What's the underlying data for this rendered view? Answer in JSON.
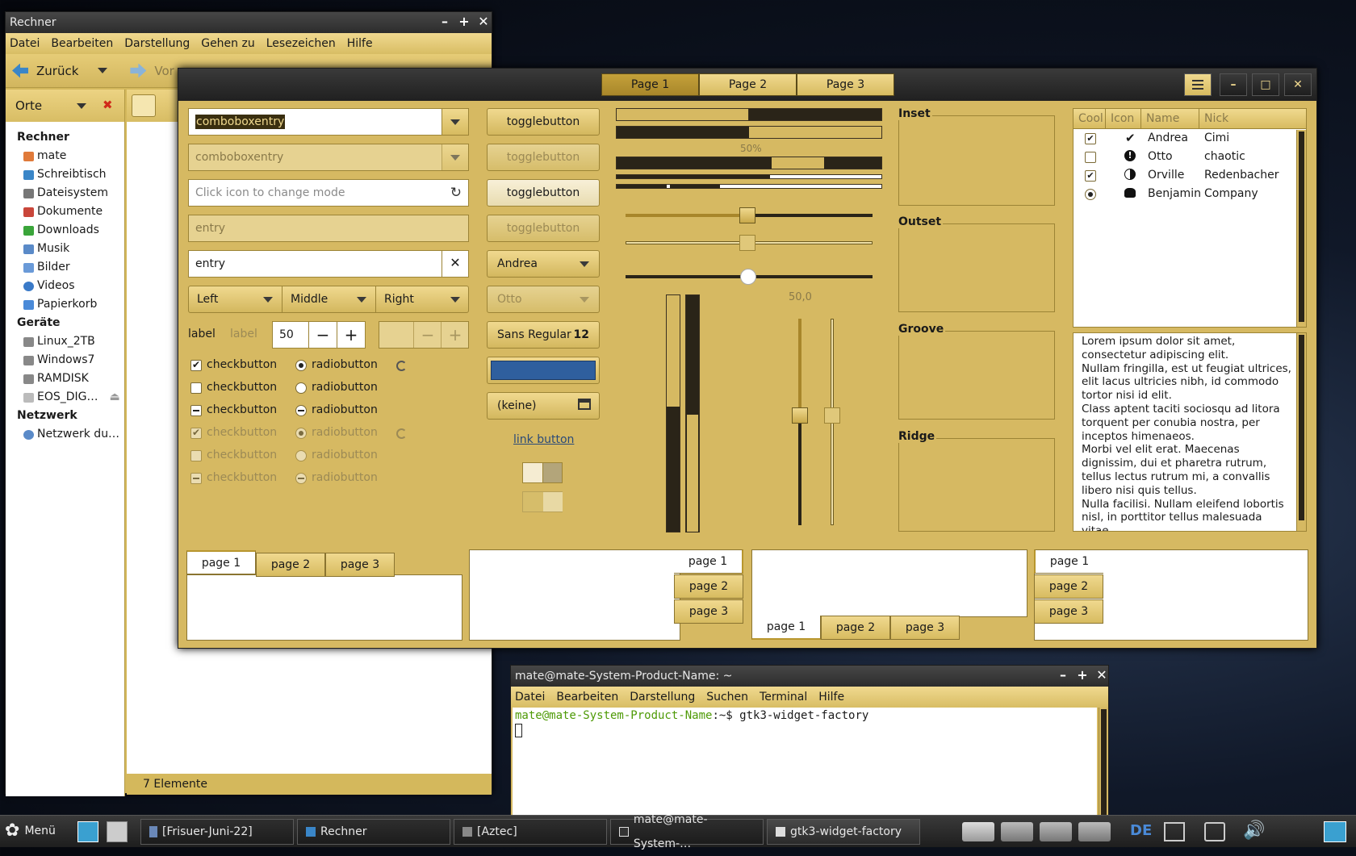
{
  "file_manager": {
    "title": "Rechner",
    "menu": [
      "Datei",
      "Bearbeiten",
      "Darstellung",
      "Gehen zu",
      "Lesezeichen",
      "Hilfe"
    ],
    "back_label": "Zurück",
    "forward_label": "Vor",
    "places_label": "Orte",
    "sections": [
      {
        "title": "Rechner",
        "items": [
          "mate",
          "Schreibtisch",
          "Dateisystem",
          "Dokumente",
          "Downloads",
          "Musik",
          "Bilder",
          "Videos",
          "Papierkorb"
        ]
      },
      {
        "title": "Geräte",
        "items": [
          "Linux_2TB",
          "Windows7",
          "RAMDISK",
          "EOS_DIG…"
        ]
      },
      {
        "title": "Netzwerk",
        "items": [
          "Netzwerk du…"
        ]
      }
    ],
    "status": "7 Elemente"
  },
  "widget_factory": {
    "stack_tabs": [
      "Page 1",
      "Page 2",
      "Page 3"
    ],
    "combo1": "comboboxentry",
    "combo2": "comboboxentry",
    "entry_placeholder": "Click icon to change mode",
    "entry_disabled": "entry",
    "entry_clear": "entry",
    "seg": [
      "Left",
      "Middle",
      "Right"
    ],
    "label1": "label",
    "label2": "label",
    "spin_value": "50",
    "checks": [
      "checkbutton",
      "checkbutton",
      "checkbutton",
      "checkbutton",
      "checkbutton",
      "checkbutton"
    ],
    "radios": [
      "radiobutton",
      "radiobutton",
      "radiobutton",
      "radiobutton",
      "radiobutton",
      "radiobutton"
    ],
    "toggles": [
      "togglebutton",
      "togglebutton",
      "togglebutton",
      "togglebutton"
    ],
    "combo_andrea": "Andrea",
    "combo_otto": "Otto",
    "font_name": "Sans Regular",
    "font_size": "12",
    "file_none": "(keine)",
    "link": "link button",
    "progress_label": "50%",
    "scale_value": "50,0",
    "frames": [
      "Inset",
      "Outset",
      "Groove",
      "Ridge"
    ],
    "tree_headers": [
      "Cool",
      "Icon",
      "Name",
      "Nick"
    ],
    "tree_rows": [
      {
        "name": "Andrea",
        "nick": "Cimi",
        "checked": true
      },
      {
        "name": "Otto",
        "nick": "chaotic",
        "checked": false
      },
      {
        "name": "Orville",
        "nick": "Redenbacher",
        "checked": true
      },
      {
        "name": "Benjamin",
        "nick": "Company",
        "checked": false
      }
    ],
    "lorem": "Lorem ipsum dolor sit amet, consectetur adipiscing elit.\nNullam fringilla, est ut feugiat ultrices, elit lacus ultricies nibh, id commodo tortor nisi id elit.\nClass aptent taciti sociosqu ad litora torquent per conubia nostra, per inceptos himenaeos.\nMorbi vel elit erat. Maecenas dignissim, dui et pharetra rutrum, tellus lectus rutrum mi, a convallis libero nisi quis tellus.\nNulla facilisi. Nullam eleifend lobortis nisl, in porttitor tellus malesuada vitae.",
    "nb_tabs": [
      "page 1",
      "page 2",
      "page 3"
    ]
  },
  "terminal": {
    "title": "mate@mate-System-Product-Name: ~",
    "menu": [
      "Datei",
      "Bearbeiten",
      "Darstellung",
      "Suchen",
      "Terminal",
      "Hilfe"
    ],
    "prompt_user": "mate@mate-System-Product-Name",
    "prompt_rest": ":~$ gtk3-widget-factory"
  },
  "taskbar": {
    "menu": "Menü",
    "tasks": [
      "[Frisuer-Juni-22]",
      "Rechner",
      "[Aztec]",
      "mate@mate-System-…",
      "gtk3-widget-factory"
    ],
    "keyboard": "DE"
  },
  "colors": {
    "accent": "#d6b962",
    "selection": "#2f5f9e",
    "prompt_green": "#4e9a06"
  }
}
